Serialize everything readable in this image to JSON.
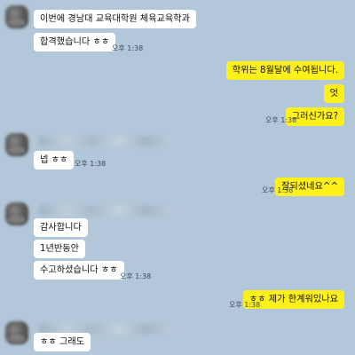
{
  "messages": [
    {
      "text": "이번에 경남대 교육대학원 체육교육학과"
    },
    {
      "text": "합격했습니다 ㅎㅎ",
      "time": "오후 1:38"
    },
    {
      "text": "학위는 8월달에 수여됩니다."
    },
    {
      "text": "엇"
    },
    {
      "text": "그러신가요?",
      "time": "오후 1:38"
    },
    {
      "text": "넵 ㅎㅎ",
      "time": "오후 1:38"
    },
    {
      "text": "잘되셨네요^^",
      "time": "오후 1:38"
    },
    {
      "text": "감사합니다"
    },
    {
      "text": "1년반동안"
    },
    {
      "text": "수고하셨습니다 ㅎㅎ",
      "time": "오후 1:38"
    },
    {
      "text": "ㅎㅎ 제가 한계워있나요",
      "time": "오후 1:38"
    },
    {
      "text": "ㅎㅎ 그래도"
    }
  ]
}
